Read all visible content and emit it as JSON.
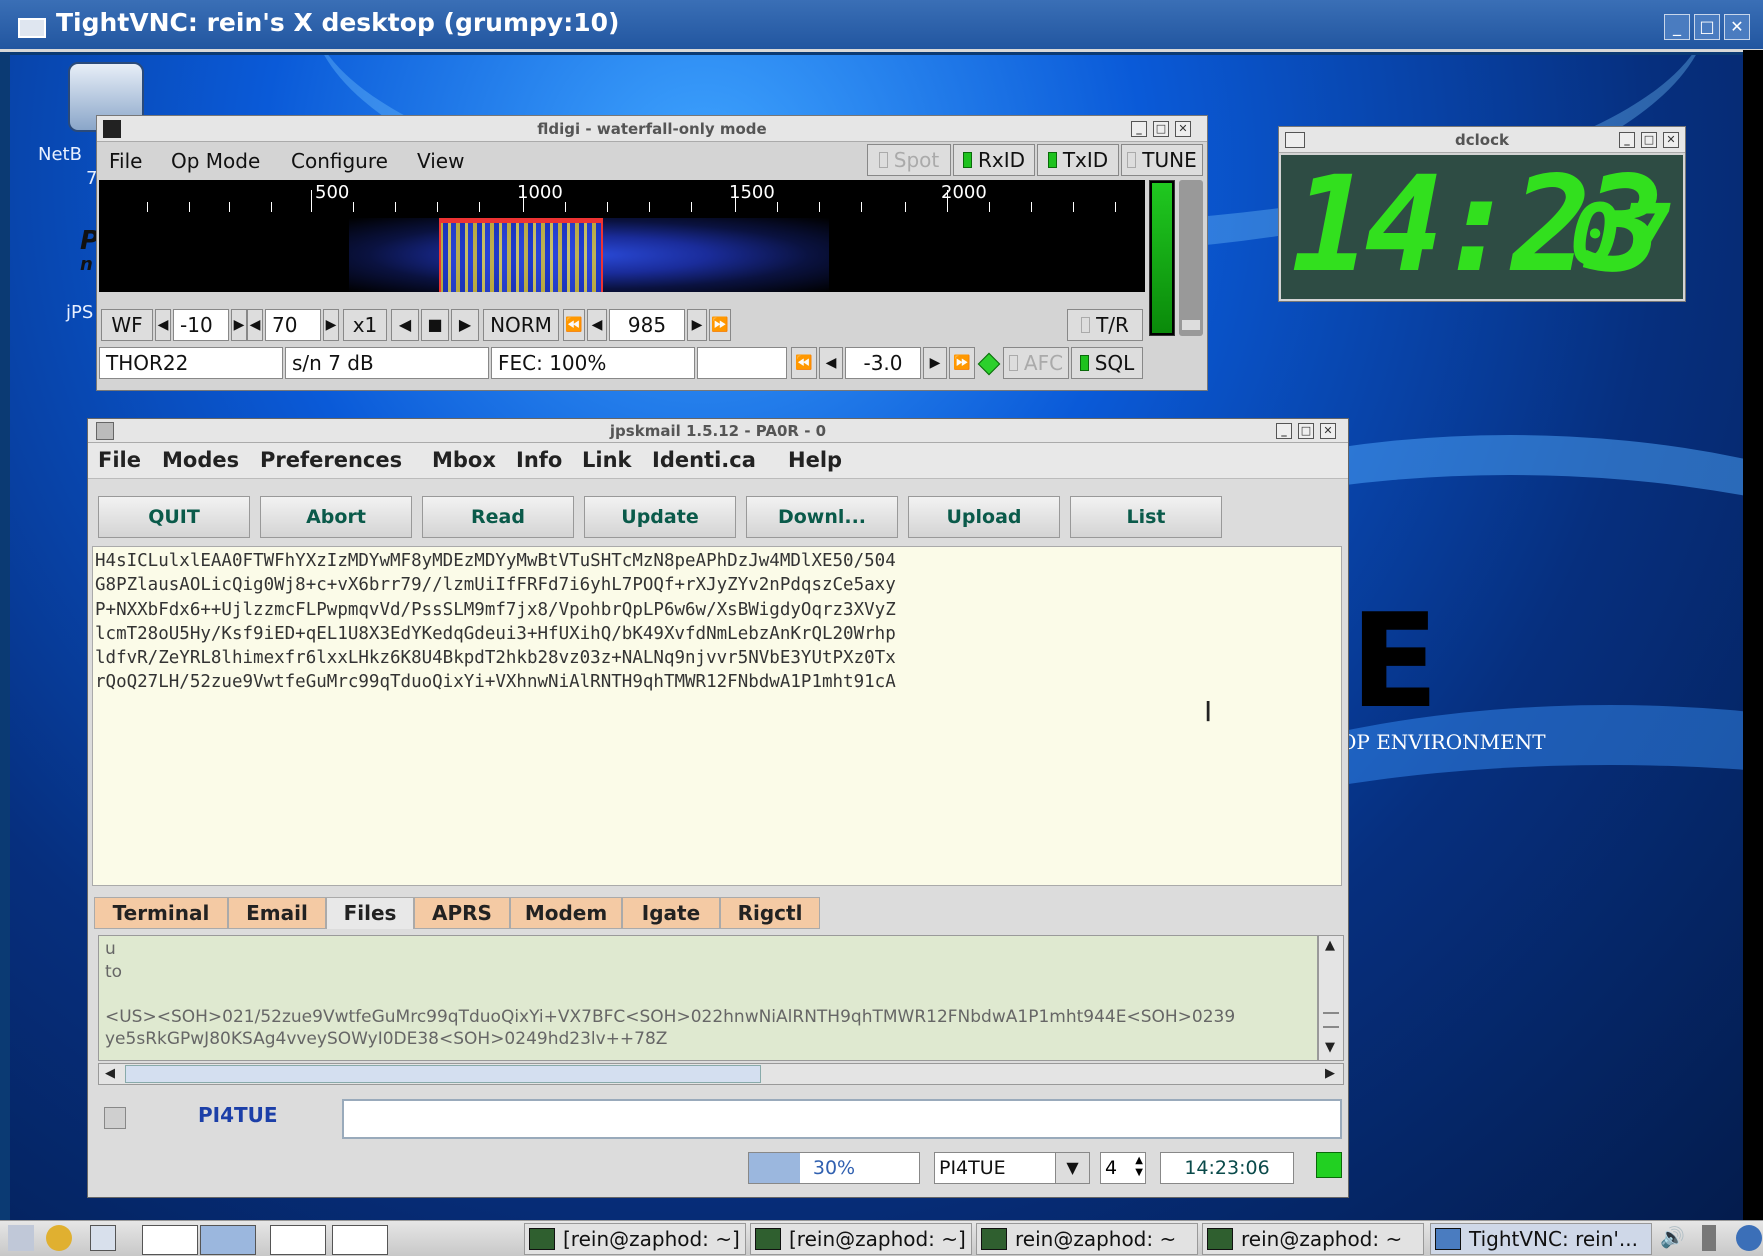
{
  "vnc": {
    "title": "TightVNC: rein's X desktop (grumpy:10)",
    "btn_min": "_",
    "btn_max": "□",
    "btn_close": "✕"
  },
  "desktop": {
    "icon_label_1": "NetB",
    "icon_label_1b": "7",
    "icon_label_2": "jPS",
    "icon_label_3": "P",
    "icon_label_4": "n",
    "bg_letter": "E",
    "bg_text": "OP ENVIRONMENT"
  },
  "fldigi": {
    "title": "fldigi - waterfall-only mode",
    "menu": [
      "File",
      "Op Mode",
      "Configure",
      "View"
    ],
    "spot": "Spot",
    "rxid": "RxID",
    "txid": "TxID",
    "tune": "TUNE",
    "scale_labels": [
      "500",
      "1000",
      "1500",
      "2000"
    ],
    "wf": "WF",
    "ref_level": "-10",
    "range": "70",
    "zoom": "x1",
    "norm": "NORM",
    "freq": "985",
    "tr": "T/R",
    "mode": "THOR22",
    "sn": "s/n   7 dB",
    "fec": "FEC: 100%",
    "squelch_level": "-3.0",
    "afc": "AFC",
    "sql": "SQL",
    "led_colors": {
      "on": "#1ec21e"
    }
  },
  "dclock": {
    "title": "dclock",
    "hhmm": "14:23",
    "ss": "07"
  },
  "jpsk": {
    "title": "jpskmail 1.5.12 - PA0R - 0",
    "menu": [
      "File",
      "Modes",
      "Preferences",
      "Mbox",
      "Info",
      "Link",
      "Identi.ca",
      "Help"
    ],
    "buttons": [
      "QUIT",
      "Abort",
      "Read",
      "Update",
      "Downl...",
      "Upload",
      "List"
    ],
    "rx_lines": [
      "H4sICLulxlEAA0FTWFhYXzIzMDYwMF8yMDEzMDYyMwBtVTuSHTcMzN8peAPhDzJw4MDlXE50/504",
      "G8PZlausAOLicQig0Wj8+c+vX6brr79//lzmUiIfFRFd7i6yhL7POQf+rXJyZYv2nPdqszCe5axy",
      "P+NXXbFdx6++UjlzzmcFLPwpmqvVd/PssSLM9mf7jx8/VpohbrQpLP6w6w/XsBWigdyOqrz3XVyZ",
      "lcmT28oU5Hy/Ksf9iED+qEL1U8X3EdYKedqGdeui3+HfUXihQ/bK49XvfdNmLebzAnKrQL20Wrhp",
      "ldfvR/ZeYRL8lhimexfr6lxxLHkz6K8U4BkpdT2hkb28vz03z+NALNq9njvvr5NVbE3YUtPXz0Tx",
      "rQoQ27LH/52zue9VwtfeGuMrc99qTduoQixYi+VXhnwNiAlRNTH9qhTMWR12FNbdwA1P1mht91cA"
    ],
    "tabs": [
      "Terminal",
      "Email",
      "Files",
      "APRS",
      "Modem",
      "Igate",
      "Rigctl"
    ],
    "active_tab": "Files",
    "term_lines": [
      "u",
      "to",
      "",
      "<US><SOH>021/52zue9VwtfeGuMrc99qTduoQixYi+VX7BFC<SOH>022hnwNiAlRNTH9qhTMWR12FNbdwA1P1mht944E<SOH>0239",
      "ye5sRkGPwJ80KSAg4vveySOWyI0DE38<SOH>0249hd23lv++78Z"
    ],
    "callsign": "PI4TUE",
    "tx_text": "",
    "progress_percent": 30,
    "progress_label": "30%",
    "server": "PI4TUE",
    "spinner": "4",
    "time": "14:23:06",
    "scroll_left": "◀",
    "scroll_right": "▶",
    "scroll_up": "▲",
    "scroll_down": "▼"
  },
  "taskbar": {
    "items": [
      "[rein@zaphod: ~]",
      "[rein@zaphod: ~]",
      "rein@zaphod: ~",
      "rein@zaphod: ~",
      "TightVNC: rein'..."
    ]
  }
}
